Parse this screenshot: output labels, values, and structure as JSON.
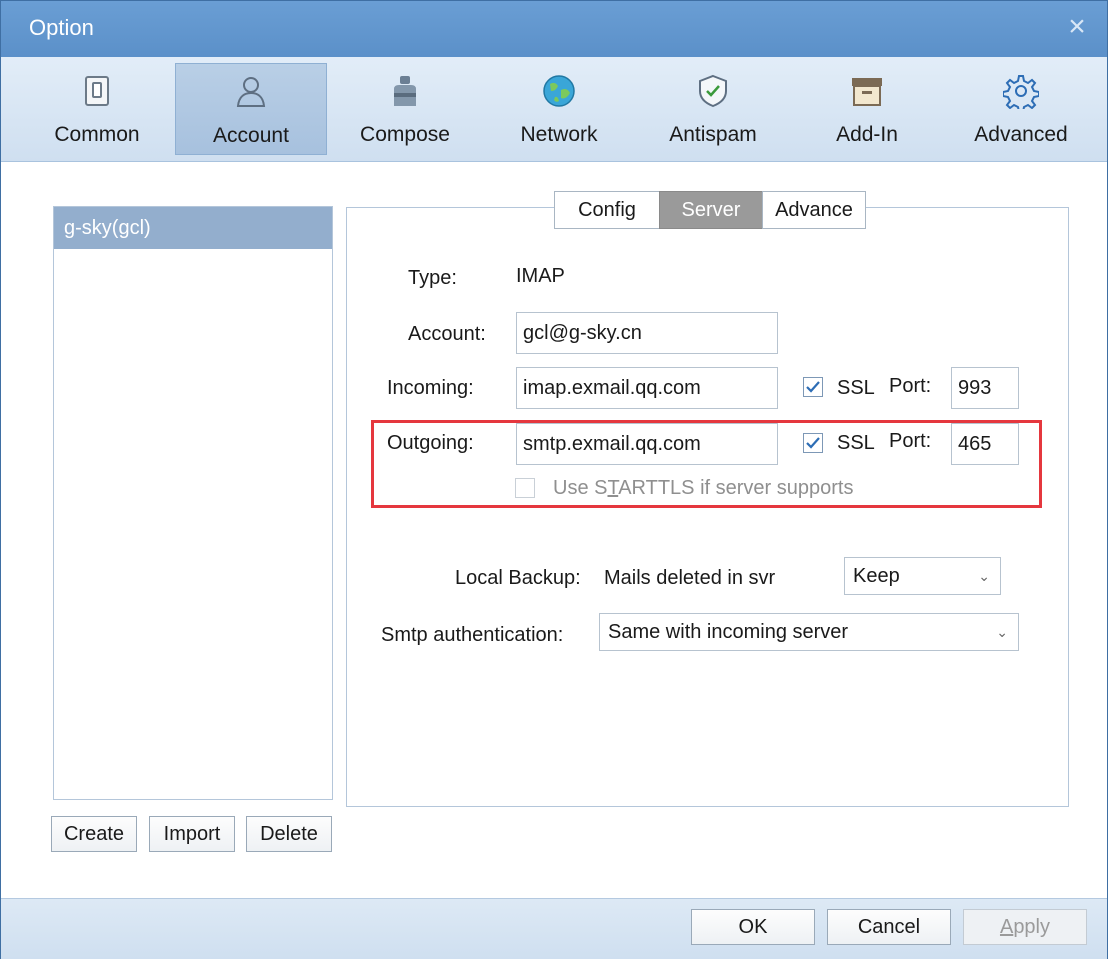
{
  "window": {
    "title": "Option",
    "close_icon": "×"
  },
  "toolbar": {
    "items": [
      {
        "label": "Common",
        "icon": "toggle-switch-icon"
      },
      {
        "label": "Account",
        "icon": "person-icon"
      },
      {
        "label": "Compose",
        "icon": "ink-bottle-icon"
      },
      {
        "label": "Network",
        "icon": "globe-icon"
      },
      {
        "label": "Antispam",
        "icon": "shield-check-icon"
      },
      {
        "label": "Add-In",
        "icon": "archive-box-icon"
      },
      {
        "label": "Advanced",
        "icon": "gear-icon"
      }
    ],
    "selected": "Account"
  },
  "accounts": {
    "items": [
      "g-sky(gcl)"
    ],
    "buttons": {
      "create": "Create",
      "import": "Import",
      "delete": "Delete"
    }
  },
  "tabs": {
    "config": "Config",
    "server": "Server",
    "advance": "Advance",
    "active": "Server"
  },
  "form": {
    "type_label": "Type:",
    "type_value": "IMAP",
    "account_label": "Account:",
    "account_value": "gcl@g-sky.cn",
    "incoming_label": "Incoming:",
    "incoming_value": "imap.exmail.qq.com",
    "incoming_ssl_label": "SSL",
    "incoming_ssl_checked": true,
    "incoming_port_label": "Port:",
    "incoming_port_value": "993",
    "outgoing_label": "Outgoing:",
    "outgoing_value": "smtp.exmail.qq.com",
    "outgoing_ssl_label": "SSL",
    "outgoing_ssl_checked": true,
    "outgoing_port_label": "Port:",
    "outgoing_port_value": "465",
    "starttls_label_pre": "Use S",
    "starttls_label_mnemonic": "T",
    "starttls_label_post": "ARTTLS if server supports",
    "starttls_checked": false,
    "local_backup_label": "Local Backup:",
    "mails_deleted_label": "Mails deleted in svr",
    "local_backup_value": "Keep",
    "smtp_auth_label": "Smtp authentication:",
    "smtp_auth_value": "Same with incoming server"
  },
  "footer": {
    "ok": "OK",
    "cancel": "Cancel",
    "apply_mnemonic": "A",
    "apply_rest": "pply"
  },
  "colors": {
    "accent": "#5b90c9",
    "highlight": "#e5373e",
    "check": "#2d6db5"
  }
}
